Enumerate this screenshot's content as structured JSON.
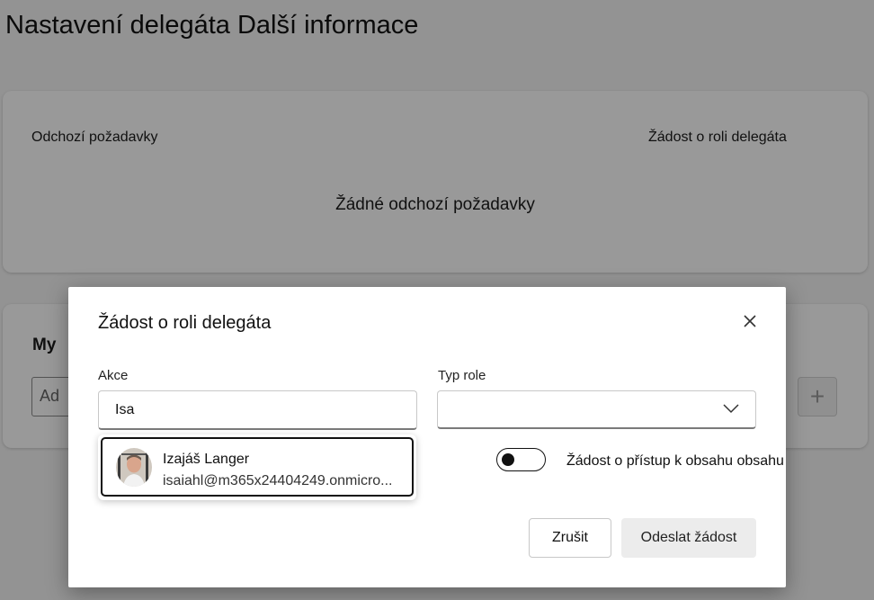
{
  "page": {
    "title": "Nastavení delegáta Další informace"
  },
  "requests_card": {
    "outgoing_label": "Odchozí požadavky",
    "role_request_label": "Žádost o roli delegáta",
    "empty_message": "Žádné odchozí požadavky"
  },
  "my_card": {
    "heading": "My",
    "add_input_text": "Ad",
    "add_button_icon": "plus-icon"
  },
  "dialog": {
    "title": "Žádost o roli delegáta",
    "close_icon": "close-icon",
    "akce_label": "Akce",
    "akce_value": "Isa",
    "typ_role_label": "Typ role",
    "typ_role_value": "",
    "suggestion": {
      "name": "Izajáš Langer",
      "email": "isaiahl@m365x24404249.onmicro..."
    },
    "toggle_label": "Žádost o přístup k obsahu obsahu",
    "toggle_on": false,
    "cancel_label": "Zrušit",
    "send_label": "Odeslat žádost"
  }
}
